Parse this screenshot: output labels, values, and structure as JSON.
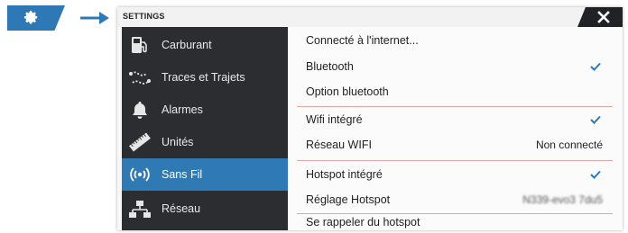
{
  "window": {
    "title": "SETTINGS"
  },
  "sidebar": {
    "items": [
      {
        "label": "Carburant",
        "icon": "fuel-pump-icon"
      },
      {
        "label": "Traces et Trajets",
        "icon": "tracks-icon"
      },
      {
        "label": "Alarmes",
        "icon": "bell-icon"
      },
      {
        "label": "Unités",
        "icon": "ruler-icon"
      },
      {
        "label": "Sans Fil",
        "icon": "wireless-icon",
        "active": true
      },
      {
        "label": "Réseau",
        "icon": "network-icon"
      }
    ]
  },
  "content": {
    "rows": [
      {
        "label": "Connecté à l'internet...",
        "type": "action"
      },
      {
        "label": "Bluetooth",
        "type": "checkbox",
        "checked": true
      },
      {
        "label": "Option bluetooth",
        "type": "action"
      },
      {
        "label": "Wifi intégré",
        "type": "checkbox",
        "checked": true
      },
      {
        "label": "Réseau WIFI",
        "type": "value",
        "value": "Non connecté"
      },
      {
        "label": "Hotspot intégré",
        "type": "checkbox",
        "checked": true
      },
      {
        "label": "Réglage Hotspot",
        "type": "value",
        "value": "N339-evo3 7du5"
      },
      {
        "label": "Se rappeler du hotspot",
        "type": "action"
      }
    ]
  },
  "colors": {
    "accent": "#2f79b5",
    "sidebar_bg": "#2b2d30",
    "separator": "#e3a6a6",
    "check": "#2f79b5"
  }
}
